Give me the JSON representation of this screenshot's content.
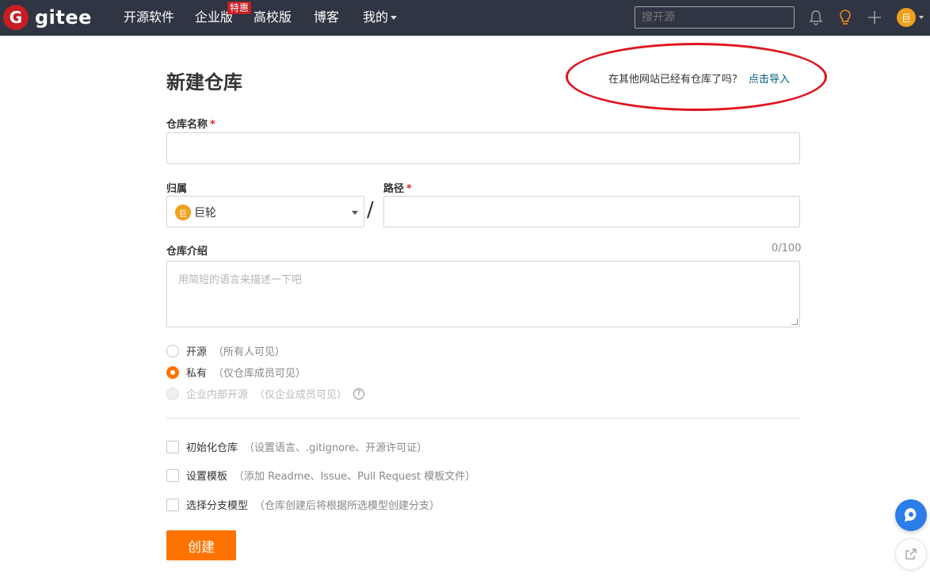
{
  "header": {
    "logo_letter": "G",
    "logo_text": "gitee",
    "nav": [
      {
        "label": "开源软件"
      },
      {
        "label": "企业版",
        "badge": "特惠"
      },
      {
        "label": "高校版"
      },
      {
        "label": "博客"
      },
      {
        "label": "我的"
      }
    ],
    "search_placeholder": "搜开源",
    "avatar_letter": "巨",
    "icons": [
      "bell-icon",
      "lightbulb-icon",
      "plus-icon"
    ]
  },
  "page": {
    "title": "新建仓库",
    "import_prompt": "在其他网站已经有仓库了吗？",
    "import_link": "点击导入"
  },
  "form": {
    "repo_name_label": "仓库名称",
    "required_mark": "*",
    "owner_label": "归属",
    "owner_value": "巨轮",
    "owner_avatar": "巨",
    "path_label": "路径",
    "slash": "/",
    "intro_label": "仓库介绍",
    "intro_counter": "0/100",
    "intro_placeholder": "用简短的语言来描述一下吧",
    "visibility": [
      {
        "label": "开源",
        "hint": "（所有人可见）",
        "state": "unchecked"
      },
      {
        "label": "私有",
        "hint": "（仅仓库成员可见）",
        "state": "checked"
      },
      {
        "label": "企业内部开源",
        "hint": "（仅企业成员可见）",
        "state": "disabled"
      }
    ],
    "help_glyph": "?",
    "options": [
      {
        "label": "初始化仓库",
        "hint": "（设置语言、.gitignore、开源许可证）"
      },
      {
        "label": "设置模板",
        "hint": "（添加 Readme、Issue、Pull Request 模板文件）"
      },
      {
        "label": "选择分支模型",
        "hint": "（仓库创建后将根据所选模型创建分支）"
      }
    ],
    "submit_label": "创建"
  },
  "colors": {
    "header_bg": "#2f3542",
    "brand_red": "#c71d23",
    "accent_orange": "#fe7300",
    "link_blue": "#005980",
    "annotation_red": "#e0141e"
  }
}
